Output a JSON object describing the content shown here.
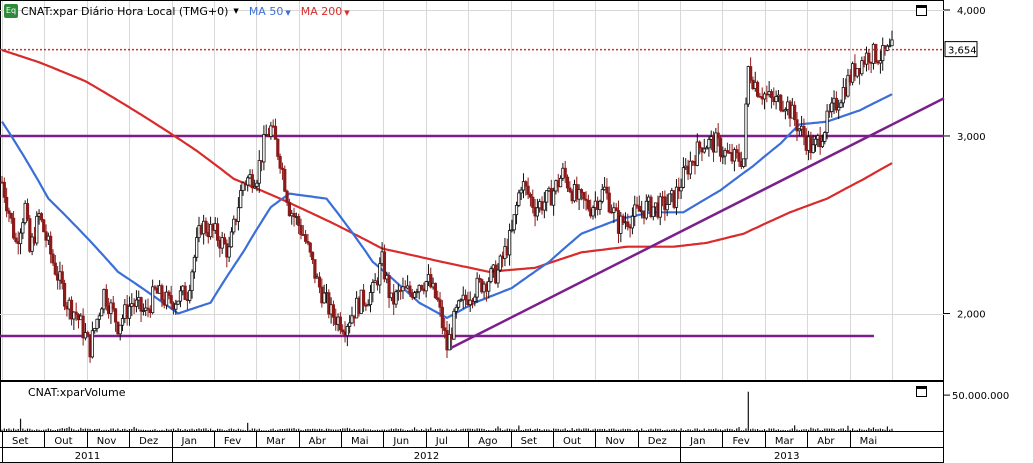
{
  "header": {
    "badge": "Eq",
    "symbol": "CNAT:xpar Diário Hora Local (TMG+0)",
    "ma50_label": "MA 50",
    "ma200_label": "MA 200"
  },
  "volume_panel": {
    "title": "CNAT:xparVolume"
  },
  "colors": {
    "ma50": "#3b6fd8",
    "ma200": "#d92b2b",
    "support_lines": "#7b1f8c",
    "last_price_line": "#d92b2b",
    "candle_up": "#111111",
    "candle_down": "#8b1a1a"
  },
  "icons": {
    "maximize_price": "maximize-icon",
    "maximize_volume": "maximize-icon"
  },
  "chart_data": [
    {
      "type": "candlestick",
      "ylim": [
        1.75,
        4.0
      ],
      "y_ticks": [
        "4,000",
        "3,000",
        "2,000"
      ],
      "y_tick_values": [
        4.0,
        3.0,
        2.0
      ],
      "last_price_label": "3,654",
      "last_price": 3.654,
      "months": [
        "Set",
        "Out",
        "Nov",
        "Dez",
        "Jan",
        "Fev",
        "Mar",
        "Abr",
        "Mai",
        "Jun",
        "Jul",
        "Ago",
        "Set",
        "Out",
        "Nov",
        "Dez",
        "Jan",
        "Fev",
        "Mar",
        "Abr",
        "Mai"
      ],
      "years": [
        "2011",
        "2012",
        "2013"
      ],
      "price_anchors": [
        {
          "t": 0,
          "v": 2.7
        },
        {
          "t": 3,
          "v": 2.35
        },
        {
          "t": 5,
          "v": 2.55
        },
        {
          "t": 6,
          "v": 2.3
        },
        {
          "t": 8,
          "v": 2.5
        },
        {
          "t": 11,
          "v": 2.25
        },
        {
          "t": 14,
          "v": 2.05
        },
        {
          "t": 16,
          "v": 2.0
        },
        {
          "t": 19,
          "v": 1.85
        },
        {
          "t": 22,
          "v": 2.1
        },
        {
          "t": 25,
          "v": 1.95
        },
        {
          "t": 28,
          "v": 2.05
        },
        {
          "t": 31,
          "v": 2.0
        },
        {
          "t": 33,
          "v": 2.1
        },
        {
          "t": 36,
          "v": 2.05
        },
        {
          "t": 40,
          "v": 2.1
        },
        {
          "t": 43,
          "v": 2.45
        },
        {
          "t": 46,
          "v": 2.4
        },
        {
          "t": 49,
          "v": 2.3
        },
        {
          "t": 52,
          "v": 2.7
        },
        {
          "t": 55,
          "v": 2.75
        },
        {
          "t": 57,
          "v": 3.0
        },
        {
          "t": 58,
          "v": 3.05
        },
        {
          "t": 60,
          "v": 2.85
        },
        {
          "t": 62,
          "v": 2.55
        },
        {
          "t": 65,
          "v": 2.4
        },
        {
          "t": 68,
          "v": 2.15
        },
        {
          "t": 71,
          "v": 2.0
        },
        {
          "t": 74,
          "v": 1.95
        },
        {
          "t": 77,
          "v": 2.05
        },
        {
          "t": 80,
          "v": 2.1
        },
        {
          "t": 82,
          "v": 2.25
        },
        {
          "t": 84,
          "v": 2.05
        },
        {
          "t": 86,
          "v": 2.1
        },
        {
          "t": 88,
          "v": 2.1
        },
        {
          "t": 90,
          "v": 2.15
        },
        {
          "t": 92,
          "v": 2.15
        },
        {
          "t": 94,
          "v": 2.05
        },
        {
          "t": 96,
          "v": 1.85
        },
        {
          "t": 98,
          "v": 2.0
        },
        {
          "t": 101,
          "v": 2.1
        },
        {
          "t": 104,
          "v": 2.15
        },
        {
          "t": 107,
          "v": 2.2
        },
        {
          "t": 110,
          "v": 2.4
        },
        {
          "t": 112,
          "v": 2.7
        },
        {
          "t": 115,
          "v": 2.55
        },
        {
          "t": 118,
          "v": 2.6
        },
        {
          "t": 121,
          "v": 2.75
        },
        {
          "t": 124,
          "v": 2.6
        },
        {
          "t": 127,
          "v": 2.55
        },
        {
          "t": 130,
          "v": 2.65
        },
        {
          "t": 133,
          "v": 2.45
        },
        {
          "t": 136,
          "v": 2.5
        },
        {
          "t": 139,
          "v": 2.55
        },
        {
          "t": 142,
          "v": 2.55
        },
        {
          "t": 145,
          "v": 2.6
        },
        {
          "t": 148,
          "v": 2.8
        },
        {
          "t": 151,
          "v": 2.95
        },
        {
          "t": 154,
          "v": 2.95
        },
        {
          "t": 157,
          "v": 2.85
        },
        {
          "t": 160,
          "v": 2.85
        },
        {
          "t": 161,
          "v": 3.5
        },
        {
          "t": 163,
          "v": 3.35
        },
        {
          "t": 166,
          "v": 3.25
        },
        {
          "t": 169,
          "v": 3.25
        },
        {
          "t": 172,
          "v": 3.05
        },
        {
          "t": 175,
          "v": 2.9
        },
        {
          "t": 178,
          "v": 3.1
        },
        {
          "t": 181,
          "v": 3.3
        },
        {
          "t": 184,
          "v": 3.5
        },
        {
          "t": 187,
          "v": 3.62
        },
        {
          "t": 190,
          "v": 3.6
        },
        {
          "t": 192,
          "v": 3.65
        }
      ],
      "ma50_anchors": [
        {
          "t": 0,
          "v": 3.1
        },
        {
          "t": 10,
          "v": 2.6
        },
        {
          "t": 25,
          "v": 2.2
        },
        {
          "t": 38,
          "v": 2.0
        },
        {
          "t": 45,
          "v": 2.05
        },
        {
          "t": 52,
          "v": 2.3
        },
        {
          "t": 58,
          "v": 2.55
        },
        {
          "t": 62,
          "v": 2.63
        },
        {
          "t": 70,
          "v": 2.6
        },
        {
          "t": 80,
          "v": 2.25
        },
        {
          "t": 90,
          "v": 2.05
        },
        {
          "t": 96,
          "v": 1.98
        },
        {
          "t": 102,
          "v": 2.05
        },
        {
          "t": 110,
          "v": 2.12
        },
        {
          "t": 118,
          "v": 2.25
        },
        {
          "t": 125,
          "v": 2.4
        },
        {
          "t": 133,
          "v": 2.48
        },
        {
          "t": 140,
          "v": 2.52
        },
        {
          "t": 147,
          "v": 2.52
        },
        {
          "t": 155,
          "v": 2.65
        },
        {
          "t": 162,
          "v": 2.8
        },
        {
          "t": 168,
          "v": 2.95
        },
        {
          "t": 172,
          "v": 3.08
        },
        {
          "t": 178,
          "v": 3.1
        },
        {
          "t": 185,
          "v": 3.18
        },
        {
          "t": 192,
          "v": 3.3
        }
      ],
      "ma200_anchors": [
        {
          "t": 0,
          "v": 3.65
        },
        {
          "t": 8,
          "v": 3.55
        },
        {
          "t": 18,
          "v": 3.4
        },
        {
          "t": 30,
          "v": 3.15
        },
        {
          "t": 42,
          "v": 2.9
        },
        {
          "t": 50,
          "v": 2.72
        },
        {
          "t": 60,
          "v": 2.6
        },
        {
          "t": 72,
          "v": 2.45
        },
        {
          "t": 82,
          "v": 2.32
        },
        {
          "t": 95,
          "v": 2.25
        },
        {
          "t": 105,
          "v": 2.2
        },
        {
          "t": 115,
          "v": 2.22
        },
        {
          "t": 125,
          "v": 2.3
        },
        {
          "t": 135,
          "v": 2.33
        },
        {
          "t": 145,
          "v": 2.33
        },
        {
          "t": 152,
          "v": 2.35
        },
        {
          "t": 160,
          "v": 2.4
        },
        {
          "t": 170,
          "v": 2.52
        },
        {
          "t": 178,
          "v": 2.6
        },
        {
          "t": 186,
          "v": 2.72
        },
        {
          "t": 192,
          "v": 2.82
        }
      ],
      "horizontal_lines": [
        3.0,
        1.9
      ],
      "trendline": {
        "from_t": 97,
        "from_v": 1.85,
        "to_v": 3.27
      }
    },
    {
      "type": "bar",
      "title": "CNAT:xparVolume",
      "y_ticks": [
        "50.000.000"
      ],
      "ylim": [
        0,
        55000000
      ],
      "volume_spikes": [
        {
          "t": 4,
          "v": 15000000
        },
        {
          "t": 53,
          "v": 10000000
        },
        {
          "t": 161,
          "v": 48000000
        }
      ]
    }
  ]
}
